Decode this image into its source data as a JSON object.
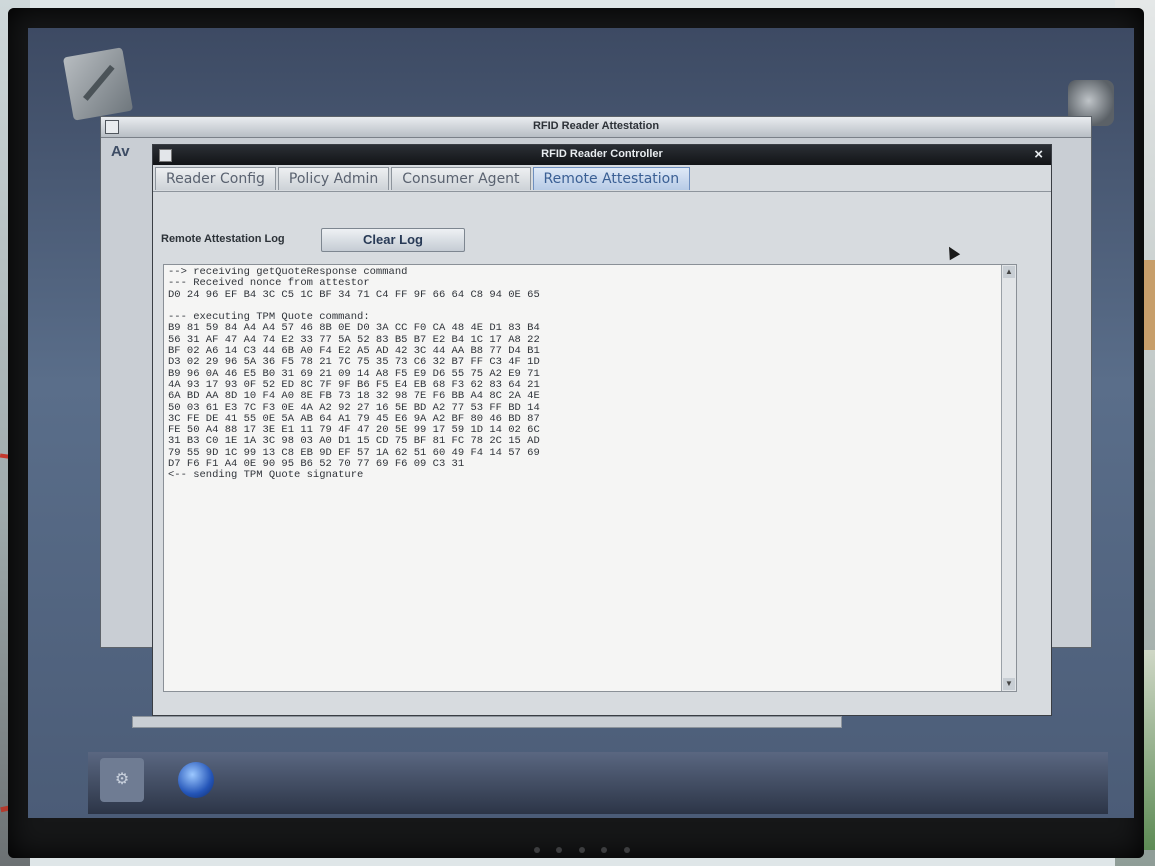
{
  "back_window": {
    "title": "RFID Reader Attestation",
    "partial_label": "Av"
  },
  "front_window": {
    "title": "RFID Reader Controller",
    "close_glyph": "×",
    "tabs": [
      {
        "label": "Reader Config",
        "active": false
      },
      {
        "label": "Policy Admin",
        "active": false
      },
      {
        "label": "Consumer Agent",
        "active": false
      },
      {
        "label": "Remote Attestation",
        "active": true
      }
    ],
    "log_label": "Remote Attestation Log",
    "clear_button": "Clear Log",
    "log_lines": [
      "--> receiving getQuoteResponse command",
      "--- Received nonce from attestor",
      "D0 24 96 EF B4 3C C5 1C BF 34 71 C4 FF 9F 66 64 C8 94 0E 65",
      "",
      "--- executing TPM Quote command:",
      "B9 81 59 84 A4 A4 57 46 8B 0E D0 3A CC F0 CA 48 4E D1 83 B4",
      "56 31 AF 47 A4 74 E2 33 77 5A 52 83 B5 B7 E2 B4 1C 17 A8 22",
      "BF 02 A6 14 C3 44 6B A0 F4 E2 A5 AD 42 3C 44 AA B8 77 D4 B1",
      "D3 02 29 96 5A 36 F5 78 21 7C 75 35 73 C6 32 B7 FF C3 4F 1D",
      "B9 96 0A 46 E5 B0 31 69 21 09 14 A8 F5 E9 D6 55 75 A2 E9 71",
      "4A 93 17 93 0F 52 ED 8C 7F 9F B6 F5 E4 EB 68 F3 62 83 64 21",
      "6A BD AA 8D 10 F4 A0 8E FB 73 18 32 98 7E F6 BB A4 8C 2A 4E",
      "50 03 61 E3 7C F3 0E 4A A2 92 27 16 5E BD A2 77 53 FF BD 14",
      "3C FE DE 41 55 0E 5A AB 64 A1 79 45 E6 9A A2 BF 80 46 BD 87",
      "FE 50 A4 88 17 3E E1 11 79 4F 47 20 5E 99 17 59 1D 14 02 6C",
      "31 B3 C0 1E 1A 3C 98 03 A0 D1 15 CD 75 BF 81 FC 78 2C 15 AD",
      "79 55 9D 1C 99 13 C8 EB 9D EF 57 1A 62 51 60 49 F4 14 57 69",
      "D7 F6 F1 A4 0E 90 95 B6 52 70 77 69 F6 09 C3 31",
      "<-- sending TPM Quote signature"
    ]
  },
  "icons": {
    "taskbar_button": "⚙",
    "scroll_up": "▲",
    "scroll_down": "▼"
  }
}
